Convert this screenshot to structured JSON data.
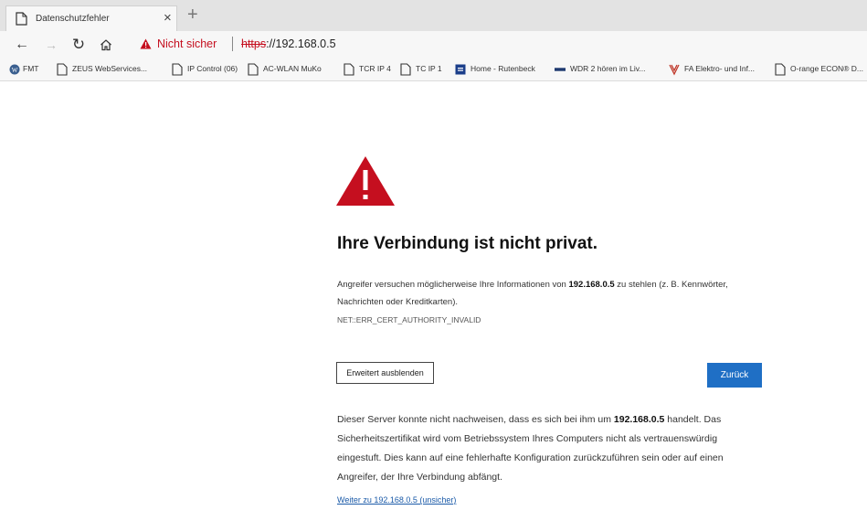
{
  "tab": {
    "title": "Datenschutzfehler",
    "close": "×",
    "new_tab": "+"
  },
  "address_bar": {
    "security_label": "Nicht sicher",
    "url_scheme": "https",
    "url_rest": "://192.168.0.5"
  },
  "bookmarks": [
    {
      "label": "FMT",
      "icon": "wordpress-icon"
    },
    {
      "label": "ZEUS WebServices...",
      "icon": "page-icon"
    },
    {
      "label": "IP Control (06)",
      "icon": "page-icon"
    },
    {
      "label": "AC-WLAN MuKo",
      "icon": "page-icon"
    },
    {
      "label": "TCR IP 4",
      "icon": "page-icon"
    },
    {
      "label": "TC IP 1",
      "icon": "page-icon"
    },
    {
      "label": "Home - Rutenbeck",
      "icon": "rutenbeck-icon"
    },
    {
      "label": "WDR 2 hören im Liv...",
      "icon": "wdr-icon"
    },
    {
      "label": "FA Elektro- und Inf...",
      "icon": "fa-icon"
    },
    {
      "label": "O-range ECON® D...",
      "icon": "page-icon"
    }
  ],
  "page": {
    "title": "Ihre Verbindung ist nicht privat.",
    "para1_a": "Angreifer versuchen möglicherweise Ihre Informationen von ",
    "para1_host": "192.168.0.5",
    "para1_b": " zu stehlen (z. B. Kennwörter, Nachrichten oder Kreditkarten).",
    "error_code": "NET::ERR_CERT_AUTHORITY_INVALID",
    "advanced_button": "Erweitert ausblenden",
    "back_button": "Zurück",
    "para2_a": "Dieser Server konnte nicht nachweisen, dass es sich bei ihm um ",
    "para2_host": "192.168.0.5",
    "para2_b": " handelt. Das Sicherheitszertifikat wird vom Betriebssystem Ihres Computers nicht als vertrauenswürdig eingestuft. Dies kann auf eine fehlerhafte Konfiguration zurückzuführen sein oder auf einen Angreifer, der Ihre Verbindung abfängt.",
    "proceed_link": "Weiter zu 192.168.0.5 (unsicher)"
  },
  "colors": {
    "warning_red": "#c50f1f",
    "accent_blue": "#1f6fc5",
    "link_blue": "#1a5aa8"
  }
}
